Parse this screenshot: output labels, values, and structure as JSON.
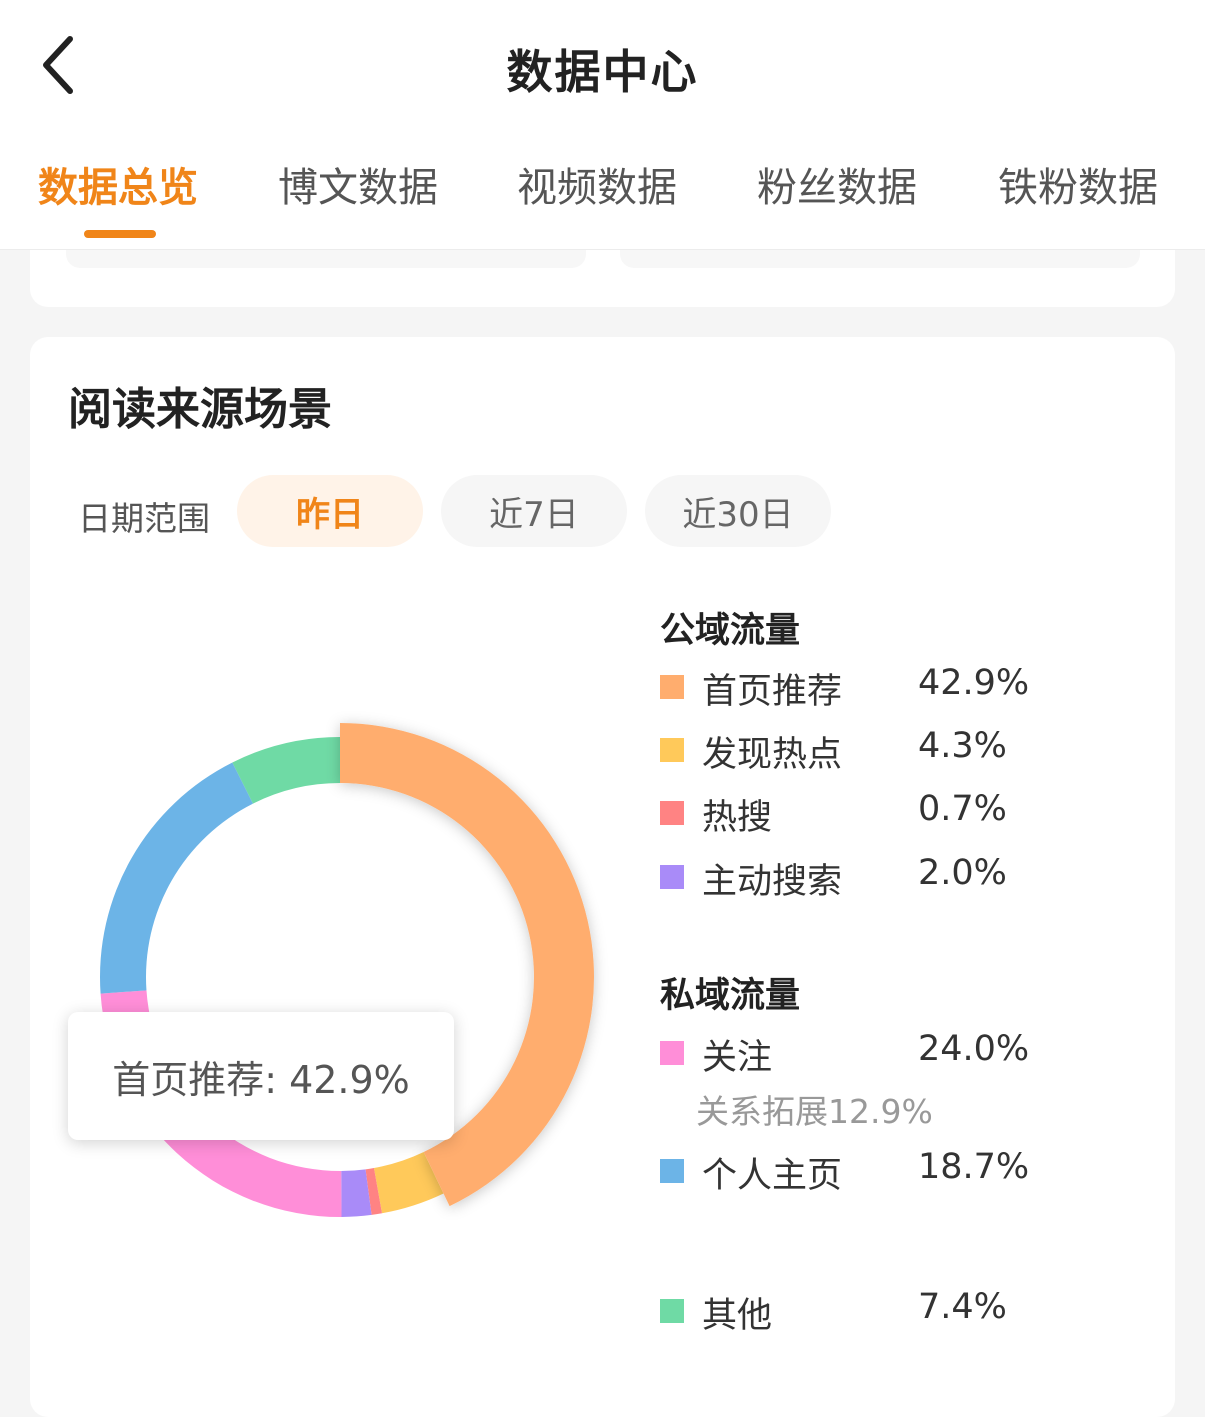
{
  "header": {
    "title": "数据中心",
    "tabs": [
      {
        "label": "数据总览",
        "active": true
      },
      {
        "label": "博文数据",
        "active": false
      },
      {
        "label": "视频数据",
        "active": false
      },
      {
        "label": "粉丝数据",
        "active": false
      },
      {
        "label": "铁粉数据",
        "active": false
      }
    ],
    "accent_color": "#f08519"
  },
  "card": {
    "title": "阅读来源场景",
    "date_range_label": "日期范围",
    "date_options": [
      {
        "label": "昨日",
        "active": true
      },
      {
        "label": "近7日",
        "active": false
      },
      {
        "label": "近30日",
        "active": false
      }
    ],
    "tooltip": "首页推荐: 42.9%",
    "public_traffic": {
      "title": "公域流量",
      "items": [
        {
          "name": "首页推荐",
          "value": "42.9%",
          "color": "#ffad6e"
        },
        {
          "name": "发现热点",
          "value": "4.3%",
          "color": "#ffc95a"
        },
        {
          "name": "热搜",
          "value": "0.7%",
          "color": "#ff8383"
        },
        {
          "name": "主动搜索",
          "value": "2.0%",
          "color": "#a98bf8"
        }
      ]
    },
    "private_traffic": {
      "title": "私域流量",
      "items": [
        {
          "name": "关注",
          "value": "24.0%",
          "color": "#ff8ed8",
          "sub": "关系拓展12.9%"
        },
        {
          "name": "个人主页",
          "value": "18.7%",
          "color": "#6cb4e7"
        }
      ]
    },
    "other": {
      "name": "其他",
      "value": "7.4%",
      "color": "#6fdaa5"
    }
  },
  "chart_data": {
    "type": "pie",
    "categories": [
      "首页推荐",
      "发现热点",
      "热搜",
      "主动搜索",
      "关注",
      "个人主页",
      "其他"
    ],
    "values": [
      42.9,
      4.3,
      0.7,
      2.0,
      24.0,
      18.7,
      7.4
    ],
    "colors": [
      "#ffad6e",
      "#ffc95a",
      "#ff8383",
      "#a98bf8",
      "#ff8ed8",
      "#6cb4e7",
      "#6fdaa5"
    ],
    "highlighted": "首页推荐",
    "donut": true
  }
}
